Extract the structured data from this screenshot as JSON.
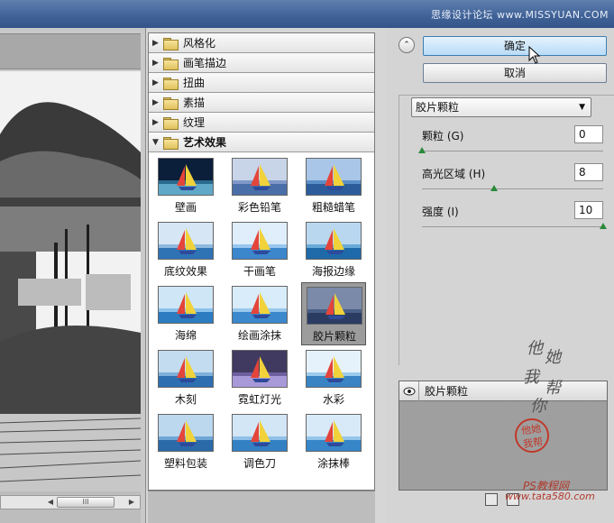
{
  "watermark_top": "思缘设计论坛 www.MISSYUAN.COM",
  "categories": [
    {
      "label": "风格化",
      "expanded": false
    },
    {
      "label": "画笔描边",
      "expanded": false
    },
    {
      "label": "扭曲",
      "expanded": false
    },
    {
      "label": "素描",
      "expanded": false
    },
    {
      "label": "纹理",
      "expanded": false
    },
    {
      "label": "艺术效果",
      "expanded": true
    }
  ],
  "thumbnails": [
    {
      "label": "壁画"
    },
    {
      "label": "彩色铅笔"
    },
    {
      "label": "粗糙蜡笔"
    },
    {
      "label": "底纹效果"
    },
    {
      "label": "干画笔"
    },
    {
      "label": "海报边缘"
    },
    {
      "label": "海绵"
    },
    {
      "label": "绘画涂抹"
    },
    {
      "label": "胶片颗粒",
      "selected": true
    },
    {
      "label": "木刻"
    },
    {
      "label": "霓虹灯光"
    },
    {
      "label": "水彩"
    },
    {
      "label": "塑料包装"
    },
    {
      "label": "调色刀"
    },
    {
      "label": "涂抹棒"
    }
  ],
  "buttons": {
    "ok": "确定",
    "cancel": "取消"
  },
  "filter_select": {
    "value": "胶片颗粒"
  },
  "params": [
    {
      "label": "颗粒 (G)",
      "value": "0",
      "level": 0.0
    },
    {
      "label": "高光区域 (H)",
      "value": "8",
      "level": 0.4
    },
    {
      "label": "强度 (I)",
      "value": "10",
      "level": 1.0
    }
  ],
  "layer": {
    "label": "胶片颗粒"
  },
  "decor": {
    "sig1": "他",
    "sig2": "她",
    "sig3": "我",
    "sig4": "帮",
    "sig5": "你",
    "seal": "他她 我帮",
    "site": "PS教程网",
    "site_url": "www.tata580.com"
  },
  "scroll_label": "III"
}
